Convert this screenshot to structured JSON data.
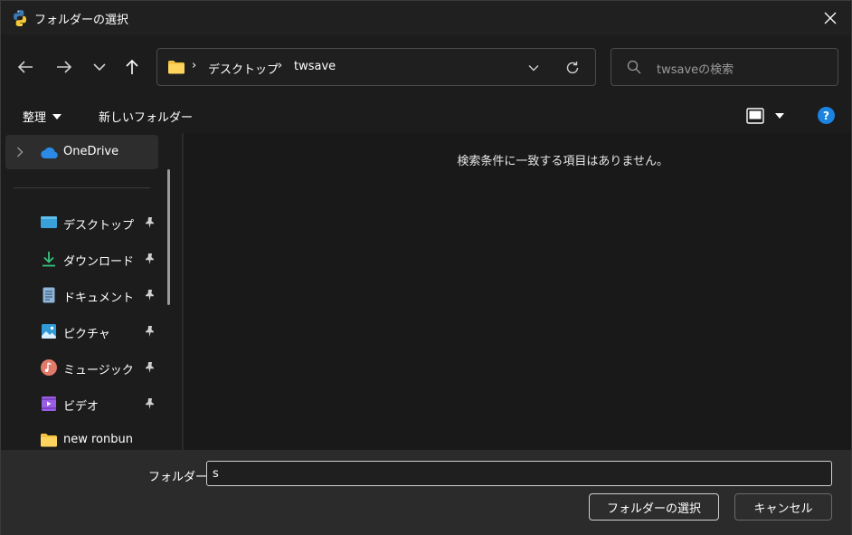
{
  "window": {
    "title": "フォルダーの選択"
  },
  "nav": {
    "breadcrumbs": [
      "デスクトップ",
      "twsave"
    ]
  },
  "search": {
    "placeholder": "twsaveの検索"
  },
  "toolbar": {
    "organize_label": "整理",
    "new_folder_label": "新しいフォルダー"
  },
  "sidebar": {
    "top_item": {
      "label": "OneDrive"
    },
    "items": [
      {
        "label": "デスクトップ",
        "icon": "desktop-icon",
        "pinned": true
      },
      {
        "label": "ダウンロード",
        "icon": "download-icon",
        "pinned": true
      },
      {
        "label": "ドキュメント",
        "icon": "document-icon",
        "pinned": true
      },
      {
        "label": "ピクチャ",
        "icon": "pictures-icon",
        "pinned": true
      },
      {
        "label": "ミュージック",
        "icon": "music-icon",
        "pinned": true
      },
      {
        "label": "ビデオ",
        "icon": "video-icon",
        "pinned": true
      },
      {
        "label": "new ronbun",
        "icon": "folder-icon",
        "pinned": false
      }
    ]
  },
  "main": {
    "empty_message": "検索条件に一致する項目はありません。"
  },
  "footer": {
    "folder_label": "フォルダー:",
    "folder_value": "s",
    "select_button": "フォルダーの選択",
    "cancel_button": "キャンセル"
  },
  "colors": {
    "accent": "#1a84e0",
    "folder": "#f5c342",
    "background": "#202020"
  }
}
